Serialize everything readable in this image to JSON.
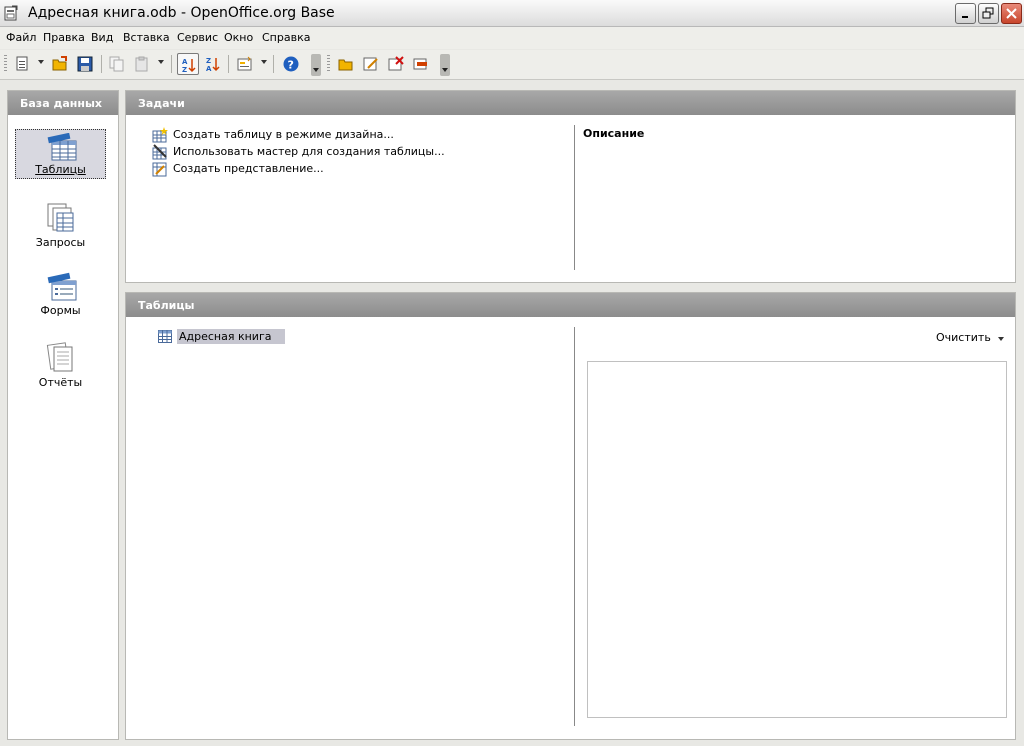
{
  "window": {
    "title": "Адресная книга.odb - OpenOffice.org Base"
  },
  "menu": [
    {
      "label": "Файл"
    },
    {
      "label": "Правка"
    },
    {
      "label": "Вид"
    },
    {
      "label": "Вставка"
    },
    {
      "label": "Сервис"
    },
    {
      "label": "Окно"
    },
    {
      "label": "Справка"
    }
  ],
  "toolbar": {
    "icons": [
      "new-document-icon",
      "open-folder-icon",
      "save-icon",
      "copy-icon",
      "paste-icon",
      "sort-ascending-icon",
      "sort-descending-icon",
      "form-icon",
      "help-icon",
      "open-db-object-icon",
      "edit-icon",
      "delete-icon",
      "rename-icon"
    ]
  },
  "sidebar": {
    "header": "База данных",
    "items": [
      {
        "label": "Таблицы",
        "icon": "tables-icon",
        "selected": true
      },
      {
        "label": "Запросы",
        "icon": "queries-icon",
        "selected": false
      },
      {
        "label": "Формы",
        "icon": "forms-icon",
        "selected": false
      },
      {
        "label": "Отчёты",
        "icon": "reports-icon",
        "selected": false
      }
    ]
  },
  "tasks": {
    "header": "Задачи",
    "items": [
      {
        "label": "Создать таблицу в режиме дизайна..."
      },
      {
        "label": "Использовать мастер для создания таблицы..."
      },
      {
        "label": "Создать представление..."
      }
    ],
    "description_title": "Описание"
  },
  "tables": {
    "header": "Таблицы",
    "items": [
      {
        "label": "Адресная книга",
        "selected": true
      }
    ],
    "clear_label": "Очистить"
  },
  "colors": {
    "header_bg": "#999999",
    "selection_bg": "#c6c6d0",
    "help_blue": "#1f5fbf"
  }
}
